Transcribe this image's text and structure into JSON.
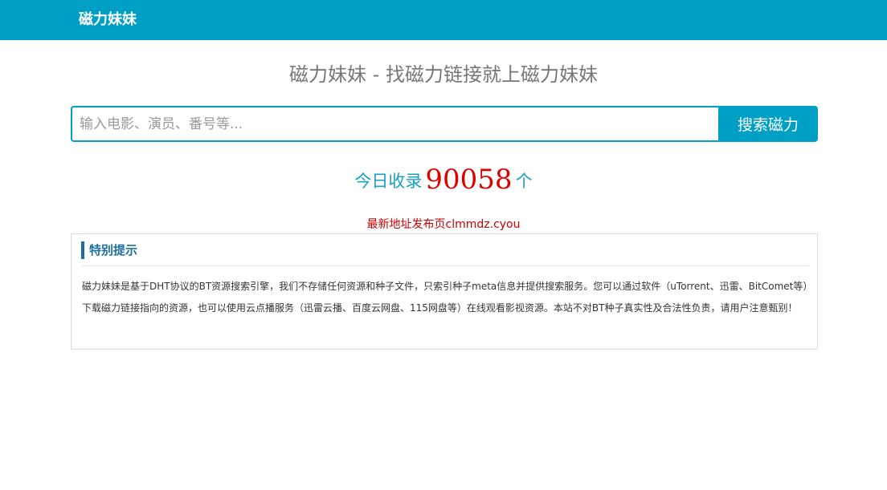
{
  "navbar": {
    "brand": "磁力妹妹",
    "background": "#00a0c6"
  },
  "header": {
    "title": "磁力妹妹 - 找磁力链接就上磁力妹妹"
  },
  "search": {
    "placeholder": "输入电影、演员、番号等...",
    "value": "",
    "button_label": "搜索磁力"
  },
  "stats": {
    "prefix": "今日收录",
    "count": "90058",
    "suffix": "个"
  },
  "notice": {
    "text": "最新地址发布页clmmdz.cyou"
  },
  "tips": {
    "title": "特别提示",
    "body": "磁力妹妹是基于DHT协议的BT资源搜索引擎，我们不存储任何资源和种子文件，只索引种子meta信息并提供搜索服务。您可以通过软件（uTorrent、迅雷、BitComet等）下载磁力链接指向的资源，也可以使用云点播服务（迅雷云播、百度云网盘、115网盘等）在线观看影视资源。本站不对BT种子真实性及合法性负责，请用户注意甄别！"
  },
  "colors": {
    "accent": "#00a0c6",
    "count_red": "#e00000",
    "notice_red": "#cc0000",
    "tip_title": "#1e6f9f"
  }
}
